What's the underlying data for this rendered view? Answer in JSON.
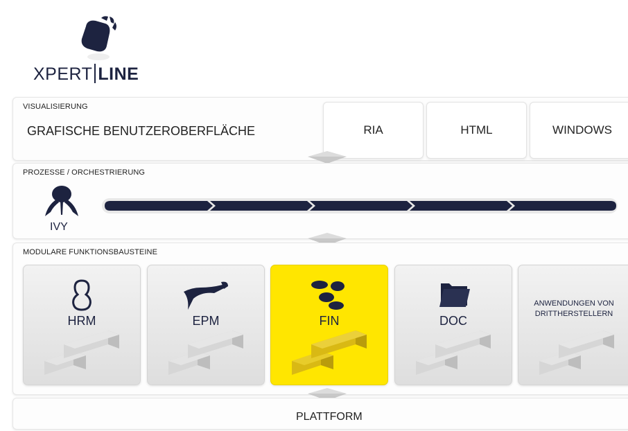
{
  "logo": {
    "brand_left": "XPERT",
    "brand_right": "LINE"
  },
  "visualization": {
    "section_label": "VISUALISIERUNG",
    "title": "GRAFISCHE BENUTZEROBERFLÄCHE",
    "options": [
      "RIA",
      "HTML",
      "WINDOWS"
    ]
  },
  "processes": {
    "section_label": "PROZESSE / ORCHESTRIERUNG",
    "engine_label": "IVY"
  },
  "modules": {
    "section_label": "MODULARE FUNKTIONSBAUSTEINE",
    "items": [
      {
        "label": "HRM",
        "icon": "pear-shape-icon",
        "highlight": false
      },
      {
        "label": "EPM",
        "icon": "seagull-icon",
        "highlight": false
      },
      {
        "label": "FIN",
        "icon": "coins-icon",
        "highlight": true
      },
      {
        "label": "DOC",
        "icon": "folder-icon",
        "highlight": false
      },
      {
        "label": "ANWENDUNGEN VON DRITTHERSTELLERN",
        "icon": "",
        "highlight": false
      }
    ]
  },
  "platform": {
    "label": "PLATTFORM"
  },
  "colors": {
    "navy": "#1d2340",
    "highlight_yellow": "#ffe600",
    "brick_gray": "#d2d2d2",
    "brick_yellow": "#e3c21a"
  }
}
